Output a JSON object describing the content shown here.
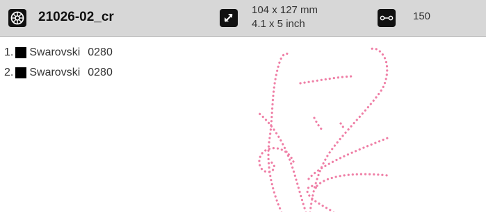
{
  "header": {
    "title": "21026-02_cr",
    "size_mm": "104 x 127 mm",
    "size_inch": "4.1 x 5 inch",
    "stone_count": "150"
  },
  "icons": {
    "design": "crystal-design-icon",
    "size": "resize-arrow-icon",
    "count": "stone-count-icon"
  },
  "colors": {
    "header_bg": "#d7d7d7",
    "icon_bg": "#111111",
    "rhinestone_pink": "#ef7fa6",
    "swatch": "#000000"
  },
  "stones": [
    {
      "index": "1.",
      "name": "Swarovski",
      "code": "0280"
    },
    {
      "index": "2.",
      "name": "Swarovski",
      "code": "0280"
    }
  ]
}
